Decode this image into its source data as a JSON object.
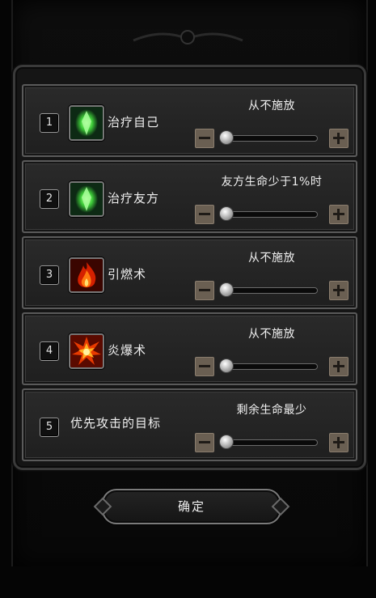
{
  "dialog": {
    "confirm_label": "确定"
  },
  "colors": {
    "panel_bg": "#151515",
    "row_bg": "#2a2a2a",
    "button_bg": "#6a5f52"
  },
  "rules": [
    {
      "number": "1",
      "label": "治疗自己",
      "icon": "green-crystal-heal-icon",
      "mode": "从不施放",
      "slider_fraction": 0.0
    },
    {
      "number": "2",
      "label": "治疗友方",
      "icon": "green-crystal-heal-icon",
      "mode": "友方生命少于1%时",
      "slider_fraction": 0.0
    },
    {
      "number": "3",
      "label": "引燃术",
      "icon": "fire-icon",
      "mode": "从不施放",
      "slider_fraction": 0.0
    },
    {
      "number": "4",
      "label": "炎爆术",
      "icon": "explosion-icon",
      "mode": "从不施放",
      "slider_fraction": 0.0
    },
    {
      "number": "5",
      "label": "优先攻击的目标",
      "icon": "",
      "mode": "剩余生命最少",
      "slider_fraction": 0.0
    }
  ]
}
